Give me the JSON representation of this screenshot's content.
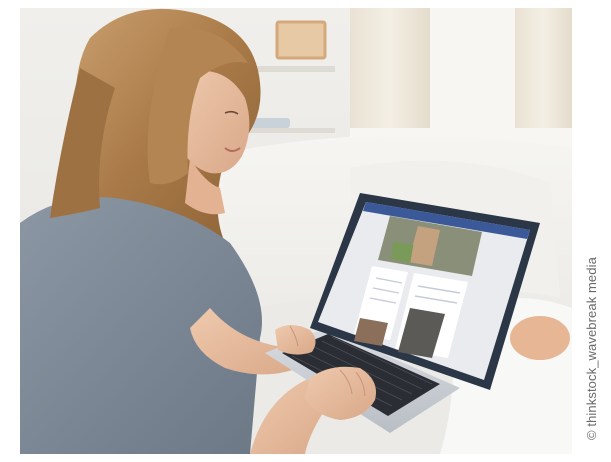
{
  "photo": {
    "subject": "woman-using-laptop-on-sofa"
  },
  "credit": {
    "text": "© thinkstock_wavebreak media"
  },
  "colors": {
    "background": "#ffffff",
    "room_wall": "#ecebe7",
    "sofa": "#f3f2ee",
    "shirt": "#7d8997",
    "hair": "#b88a58",
    "skin": "#e7bea0",
    "laptop_frame": "#2b3647",
    "credit_text": "#6a6a6a"
  }
}
